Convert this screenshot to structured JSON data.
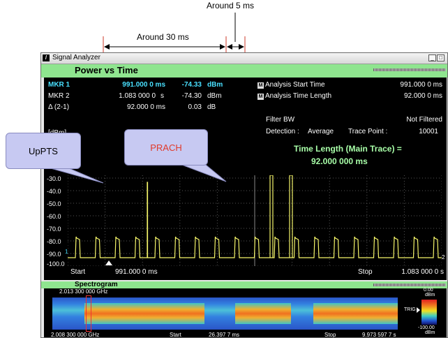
{
  "annotations": {
    "around_5ms": "Around 5 ms",
    "around_30ms": "Around 30 ms",
    "callout_uppts": "UpPTS",
    "callout_prach": "PRACH"
  },
  "window": {
    "title": "Signal Analyzer"
  },
  "panel": {
    "title": "Power vs Time"
  },
  "markers": [
    {
      "label": "MKR 1",
      "time": "991.000 0 ms",
      "level": "-74.33",
      "unit": "dBm"
    },
    {
      "label": "MKR 2",
      "time": "1.083 000 0",
      "time_unit": "s",
      "level": "-74.30",
      "unit": "dBm"
    },
    {
      "label": "Δ (2-1)",
      "time": "92.000 0 ms",
      "level": "0.03",
      "unit": "dB"
    }
  ],
  "analysis": {
    "start_label": "Analysis Start Time",
    "start_value": "991.000 0 ms",
    "length_label": "Analysis Time Length",
    "length_value": "92.000 0 ms",
    "filter_label": "Filter BW",
    "filter_value": "Not Filtered",
    "detection_label": "Detection :",
    "detection_value": "Average",
    "trace_point_label": "Trace Point :",
    "trace_point_value": "10001"
  },
  "time_length": {
    "label": "Time Length (Main Trace) =",
    "value": "92.000 000 ms"
  },
  "y_axis": {
    "unit": "[dBm]",
    "ticks": [
      "-30.0",
      "-40.0",
      "-50.0",
      "-60.0",
      "-70.0",
      "-80.0",
      "-90.0",
      "-100.0"
    ]
  },
  "x_axis": {
    "start_label": "Start",
    "start_value": "991.000 0 ms",
    "stop_label": "Stop",
    "stop_value": "1.083 000 0 s"
  },
  "spectrogram": {
    "title": "Spectrogram",
    "freq_top": "2.013 300 000 GHz",
    "freq_bottom": "2.008 300 000 GHz",
    "start_label": "Start",
    "start_value": "26.397 7 ms",
    "stop_label": "Stop",
    "stop_value": "9.973 597 7 s",
    "scale_top": "0.00",
    "scale_top_unit": "dBm",
    "scale_bottom": "-100.00",
    "scale_bottom_unit": "dBm",
    "trig_label": "TRIG"
  },
  "colors": {
    "trace": "#f5f56a",
    "marker_text": "#49e0ff",
    "panel_header": "#8fe58f",
    "callout": "#c7c9f2"
  }
}
